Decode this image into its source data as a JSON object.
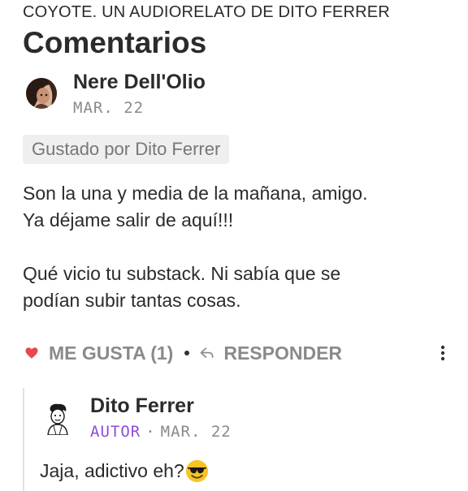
{
  "publication": {
    "title": "COYOTE. UN AUDIORELATO DE DITO FERRER"
  },
  "section": {
    "title": "Comentarios"
  },
  "comment": {
    "author": "Nere Dell'Olio",
    "date": "MAR. 22",
    "liked_by": "Gustado por Dito Ferrer",
    "paragraphs": [
      "Son la una y media de la mañana, amigo.\nYa déjame salir de aquí!!!",
      "Qué vicio tu substack. Ni sabía que se\npodían subir tantas cosas."
    ],
    "actions": {
      "like_label": "ME GUSTA (1)",
      "reply_label": "RESPONDER",
      "like_icon": "heart-icon",
      "reply_icon": "reply-arrow-icon",
      "more_icon": "vertical-ellipsis-icon"
    },
    "colors": {
      "heart": "#e5484d",
      "author_role": "#8a4fd8"
    }
  },
  "reply": {
    "author": "Dito Ferrer",
    "role": "AUTOR",
    "separator": "·",
    "date": "MAR. 22",
    "text": "Jaja, adictivo eh?",
    "emoji": "smiling-face-with-sunglasses-icon"
  }
}
